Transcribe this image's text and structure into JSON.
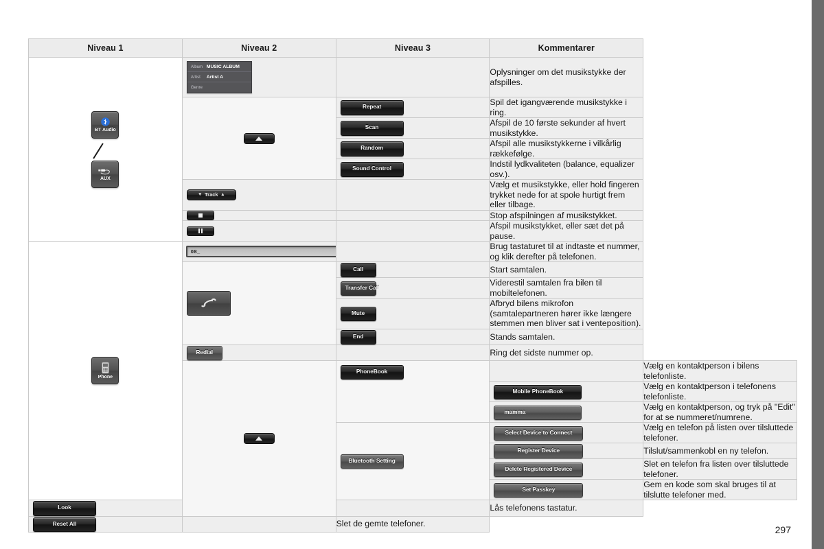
{
  "page": {
    "number": "297"
  },
  "table": {
    "headers": {
      "level1": "Niveau 1",
      "level2": "Niveau 2",
      "level3": "Niveau 3",
      "comments": "Kommentarer"
    }
  },
  "sources": {
    "bt_audio": {
      "label": "BT Audio",
      "icon": "bluetooth-icon"
    },
    "aux": {
      "label": "AUX",
      "icon": "aux-cable-icon"
    },
    "phone": {
      "label": "Phone",
      "icon": "mobile-phone-icon"
    }
  },
  "media_panel": {
    "rows": [
      {
        "key": "Album",
        "value": "MUSIC ALBUM"
      },
      {
        "key": "Artist",
        "value": "Artist A"
      },
      {
        "key": "Genre",
        "value": ""
      }
    ]
  },
  "audio": {
    "up_button": "up-arrow-button",
    "repeat": "Repeat",
    "scan": "Scan",
    "random": "Random",
    "sound_control": "Sound Control",
    "track": "Track",
    "stop": "stop-button",
    "pause": "pause-button"
  },
  "phone": {
    "number_field": {
      "value": "08_",
      "placeholder": ""
    },
    "call_icon_button": "handset-call-button",
    "call": "Call",
    "transfer_call": "Transfer Call",
    "mute": "Mute",
    "end": "End",
    "redial": "Redial",
    "phonebook": "PhoneBook",
    "mobile_phonebook": "Mobile PhoneBook",
    "contact_entry": "mamma",
    "bluetooth_setting": "Bluetooth Setting",
    "select_device": "Select Device to  Connect",
    "register_device": "Register Device",
    "delete_registered_device": "Delete Registered Device",
    "set_passkey": "Set Passkey",
    "lock": "Look",
    "reset_all": "Reset All",
    "up_button": "up-arrow-button"
  },
  "comments": {
    "c1": "Oplysninger om det musikstykke der afspilles.",
    "c2": "Spil det igangværende musikstykke i ring.",
    "c3": "Afspil de 10 første sekunder af hvert musikstykke.",
    "c4": "Afspil alle musikstykkerne i vilkårlig rækkefølge.",
    "c5": "Indstil lydkvaliteten (balance, equalizer osv.).",
    "c6": "Vælg et musikstykke, eller hold fingeren trykket nede for at spole hurtigt frem eller tilbage.",
    "c7": "Stop afspilningen af musikstykket.",
    "c8": "Afspil musikstykket, eller sæt det på pause.",
    "c9": "Brug tastaturet til at indtaste et nummer, og klik derefter på telefonen.",
    "c10": "Start samtalen.",
    "c11": "Viderestil samtalen fra bilen til mobiltelefonen.",
    "c12": "Afbryd bilens mikrofon (samtalepartneren hører ikke længere stemmen men bliver sat i venteposition).",
    "c13": "Stands samtalen.",
    "c14": "Ring det sidste nummer op.",
    "c15": "Vælg en kontaktperson i bilens telefonliste.",
    "c16": "Vælg en kontaktperson i telefonens telefonliste.",
    "c17": "Vælg en kontaktperson, og tryk på \"Edit\" for at se nummeret/numrene.",
    "c18": "Vælg en telefon på listen over tilsluttede telefoner.",
    "c19": "Tilslut/sammenkobl en ny telefon.",
    "c20": "Slet en telefon fra listen over tilsluttede telefoner.",
    "c21": "Gem en kode som skal bruges til at tilslutte telefoner med.",
    "c22": "Lås telefonens tastatur.",
    "c23": "Slet de gemte telefoner."
  }
}
